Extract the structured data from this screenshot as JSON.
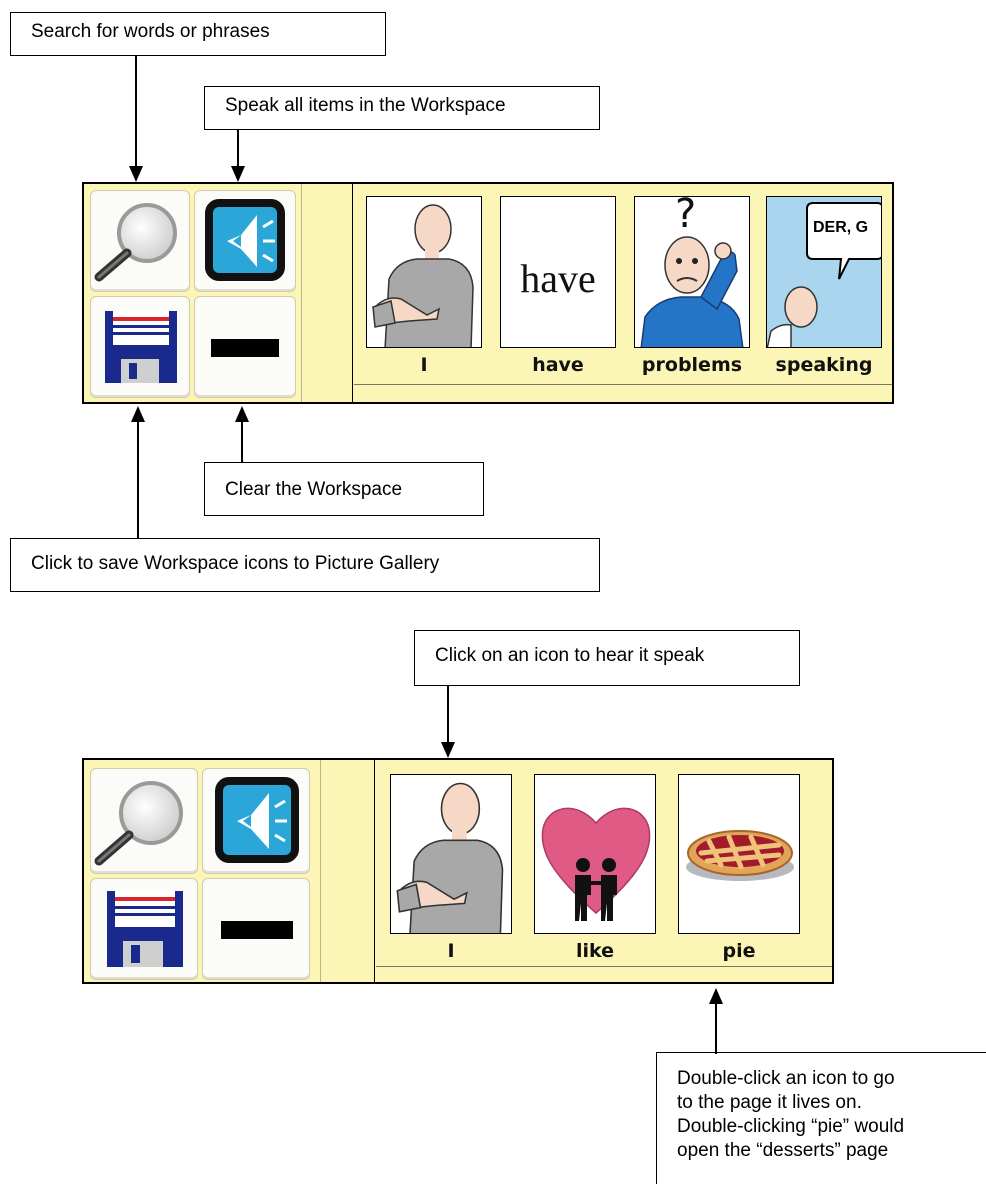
{
  "callouts": {
    "search": "Search for words or phrases",
    "speak_all": "Speak all items in the Workspace",
    "clear": "Clear the Workspace",
    "save": "Click  to save Workspace icons to Picture Gallery",
    "click_icon": "Click on an  icon to hear it speak",
    "double_click": [
      "Double-click an icon to go",
      "to the page it lives on.",
      "Double-clicking “pie” would",
      "open the “desserts” page"
    ]
  },
  "workspace_top": {
    "controls": [
      "magnifier-icon",
      "speaker-icon",
      "floppy-disk-icon",
      "clear-dash-icon"
    ],
    "cards": [
      {
        "label": "I",
        "icon": "person-pointing-self-icon"
      },
      {
        "label": "have",
        "icon": "word-card",
        "word": "have"
      },
      {
        "label": "problems",
        "icon": "confused-man-icon",
        "glyph": "?"
      },
      {
        "label": "speaking",
        "icon": "person-speech-bubble-icon",
        "bubble": "DER, G"
      }
    ]
  },
  "workspace_bottom": {
    "controls": [
      "magnifier-icon",
      "speaker-icon",
      "floppy-disk-icon",
      "clear-dash-icon"
    ],
    "cards": [
      {
        "label": "I",
        "icon": "person-pointing-self-icon"
      },
      {
        "label": "like",
        "icon": "heart-couple-icon"
      },
      {
        "label": "pie",
        "icon": "pie-icon"
      }
    ]
  },
  "colors": {
    "panel": "#fbf5b6",
    "speaker_blue": "#2aa7d8",
    "floppy_blue": "#1a2a8c",
    "heart": "#e05a86"
  }
}
